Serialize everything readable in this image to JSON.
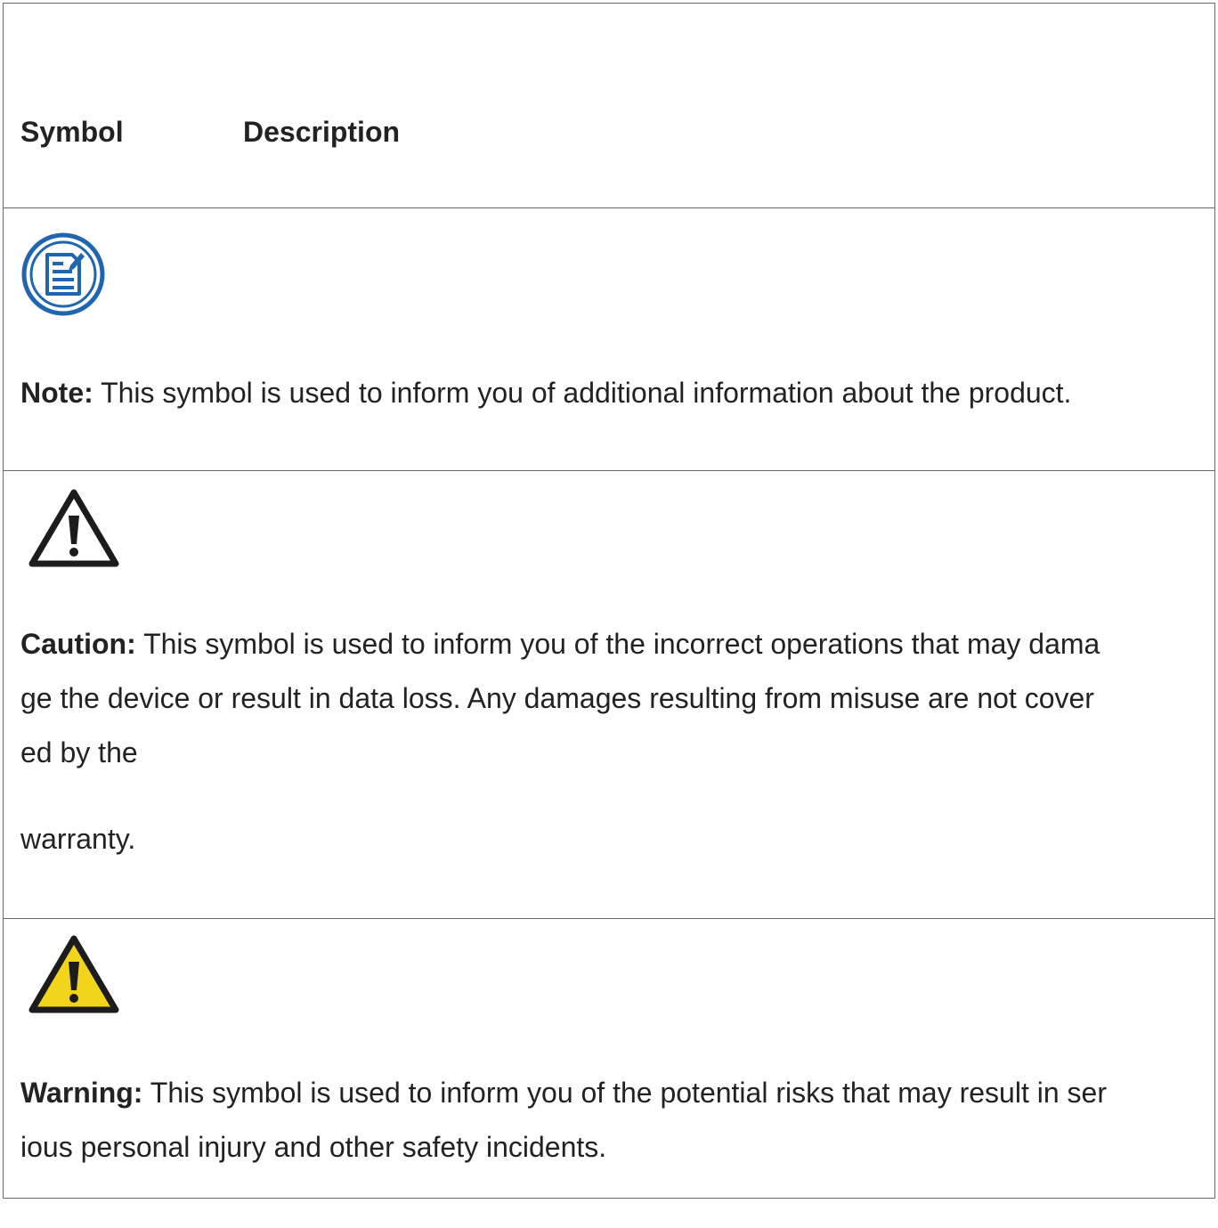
{
  "table": {
    "headers": {
      "symbol": "Symbol",
      "description": "Description"
    },
    "rows": [
      {
        "icon": "note-icon",
        "label": "Note:",
        "lines": [
          " This symbol is used to inform you of additional information about the product."
        ]
      },
      {
        "icon": "caution-icon",
        "label": "Caution:",
        "lines": [
          " This symbol is used to inform you of the incorrect operations that may dama",
          "ge the device or result in data loss. Any damages resulting from misuse are not cover",
          "ed by the",
          "warranty."
        ]
      },
      {
        "icon": "warning-icon",
        "label": "Warning:",
        "lines": [
          " This symbol is used to inform you of the potential risks that may result in ser",
          "ious personal injury and other safety incidents."
        ]
      }
    ]
  },
  "colors": {
    "note_blue": "#1f66ae",
    "warning_yellow": "#f2d51a",
    "border": "#6b6b6b"
  }
}
